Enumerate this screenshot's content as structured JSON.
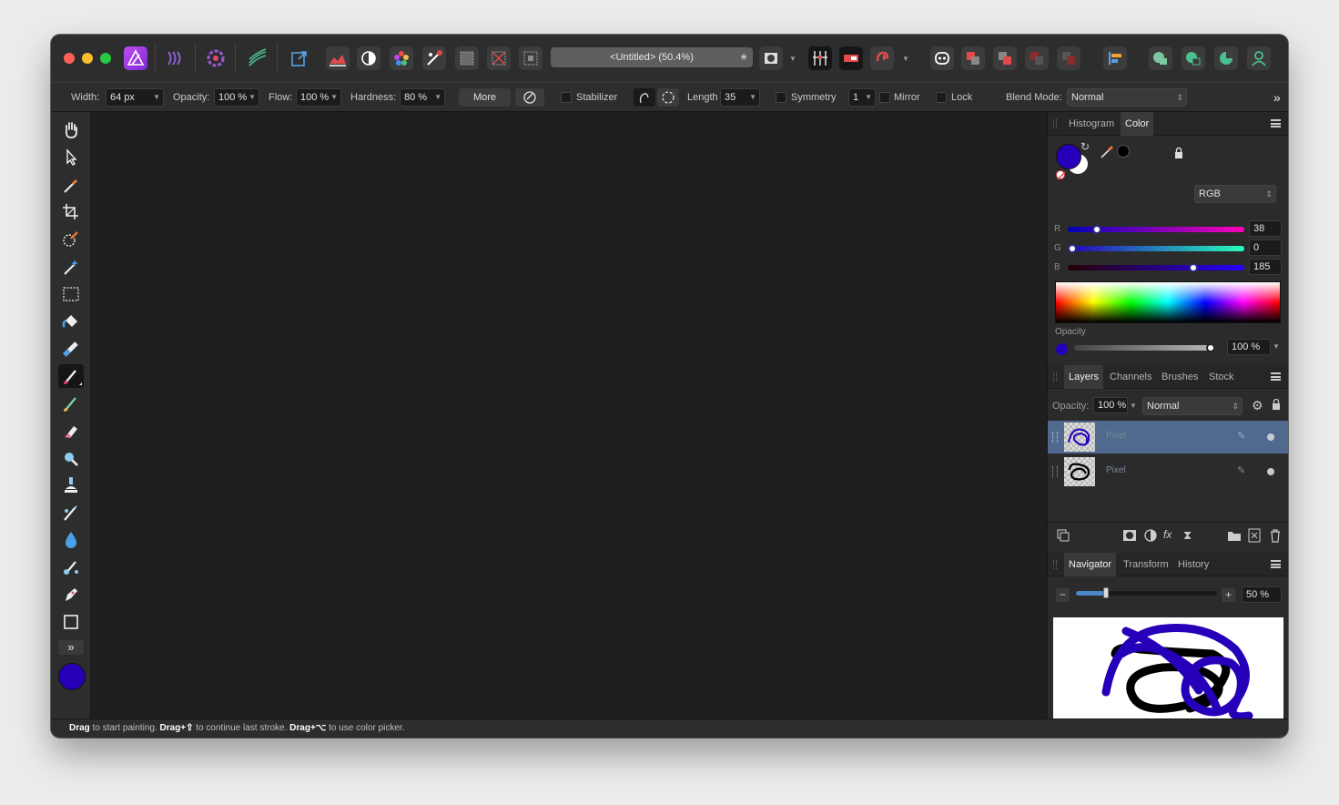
{
  "title_bar": {
    "document_title": "<Untitled> (50.4%)",
    "traffic_lights": [
      "close",
      "minimize",
      "zoom"
    ]
  },
  "context_toolbar": {
    "width_label": "Width:",
    "width_value": "64 px",
    "opacity_label": "Opacity:",
    "opacity_value": "100 %",
    "flow_label": "Flow:",
    "flow_value": "100 %",
    "hardness_label": "Hardness:",
    "hardness_value": "80 %",
    "more_label": "More",
    "stabilizer_label": "Stabilizer",
    "length_label": "Length",
    "length_value": "35",
    "symmetry_label": "Symmetry",
    "symmetry_value": "1",
    "mirror_label": "Mirror",
    "lock_label": "Lock",
    "blend_mode_label": "Blend Mode:",
    "blend_mode_value": "Normal",
    "overflow_glyph": "»"
  },
  "tools": [
    {
      "name": "hand-tool-icon"
    },
    {
      "name": "move-tool-icon"
    },
    {
      "name": "color-picker-tool-icon"
    },
    {
      "name": "crop-tool-icon"
    },
    {
      "name": "selection-brush-tool-icon"
    },
    {
      "name": "flood-select-tool-icon"
    },
    {
      "name": "rectangular-marquee-tool-icon"
    },
    {
      "name": "flood-fill-tool-icon"
    },
    {
      "name": "gradient-tool-icon"
    },
    {
      "name": "paint-brush-tool-icon",
      "active": true
    },
    {
      "name": "color-replacement-tool-icon"
    },
    {
      "name": "erase-brush-tool-icon"
    },
    {
      "name": "dodge-brush-tool-icon"
    },
    {
      "name": "clone-brush-tool-icon"
    },
    {
      "name": "blemish-removal-tool-icon"
    },
    {
      "name": "blur-brush-tool-icon"
    },
    {
      "name": "inpainting-brush-tool-icon"
    },
    {
      "name": "pen-tool-icon"
    },
    {
      "name": "rectangle-tool-icon"
    }
  ],
  "toolbar_expand_glyph": "»",
  "color_panel": {
    "tabs": [
      "Histogram",
      "Color"
    ],
    "active_tab": "Color",
    "mode": "RGB",
    "r_label": "R",
    "r_value": "38",
    "g_label": "G",
    "g_value": "0",
    "b_label": "B",
    "b_value": "185",
    "opacity_label": "Opacity",
    "opacity_value": "100 %",
    "primary_color": "#2600b9",
    "secondary_color": "#ffffff",
    "r_fraction": 0.149,
    "g_fraction": 0.0,
    "b_fraction": 0.725,
    "opacity_fraction": 1.0
  },
  "layers_panel": {
    "tabs": [
      "Layers",
      "Channels",
      "Brushes",
      "Stock"
    ],
    "active_tab": "Layers",
    "opacity_label": "Opacity:",
    "opacity_value": "100 %",
    "blend_mode": "Normal",
    "layers": [
      {
        "name": "Pixel",
        "selected": true,
        "stroke_color": "#2600b9"
      },
      {
        "name": "Pixel",
        "selected": false,
        "stroke_color": "#000000"
      }
    ]
  },
  "navigator_panel": {
    "tabs": [
      "Navigator",
      "Transform",
      "History"
    ],
    "active_tab": "Navigator",
    "zoom_value": "50 %",
    "zoom_fraction": 0.2
  },
  "status_bar": {
    "a_bold": "Drag",
    "a_text": " to start painting. ",
    "b_bold": "Drag+⇧",
    "b_text": " to continue last stroke. ",
    "c_bold": "Drag+⌥",
    "c_text": " to use color picker."
  }
}
